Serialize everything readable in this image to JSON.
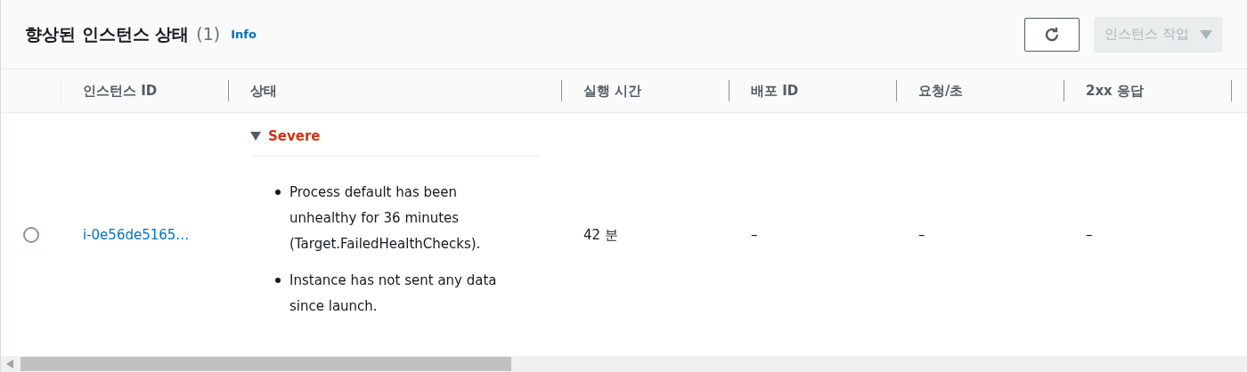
{
  "header": {
    "title": "향상된 인스턴스 상태",
    "count": "(1)",
    "info_link": "Info",
    "actions_button": {
      "label": "인스턴스 작업",
      "disabled": true
    }
  },
  "table": {
    "columns": [
      "인스턴스 ID",
      "상태",
      "실행 시간",
      "배포 ID",
      "요청/초",
      "2xx 응답"
    ],
    "rows": [
      {
        "selected": false,
        "instance_id": "i-0e56de5165…",
        "status": {
          "label": "Severe",
          "expanded": true,
          "messages": [
            "Process default has been unhealthy for 36 minutes (Target.FailedHealthChecks).",
            "Instance has not sent any data since launch."
          ]
        },
        "running_time": "42 분",
        "deployment_id": "–",
        "requests_per_sec": "–",
        "responses_2xx": "–"
      }
    ]
  }
}
